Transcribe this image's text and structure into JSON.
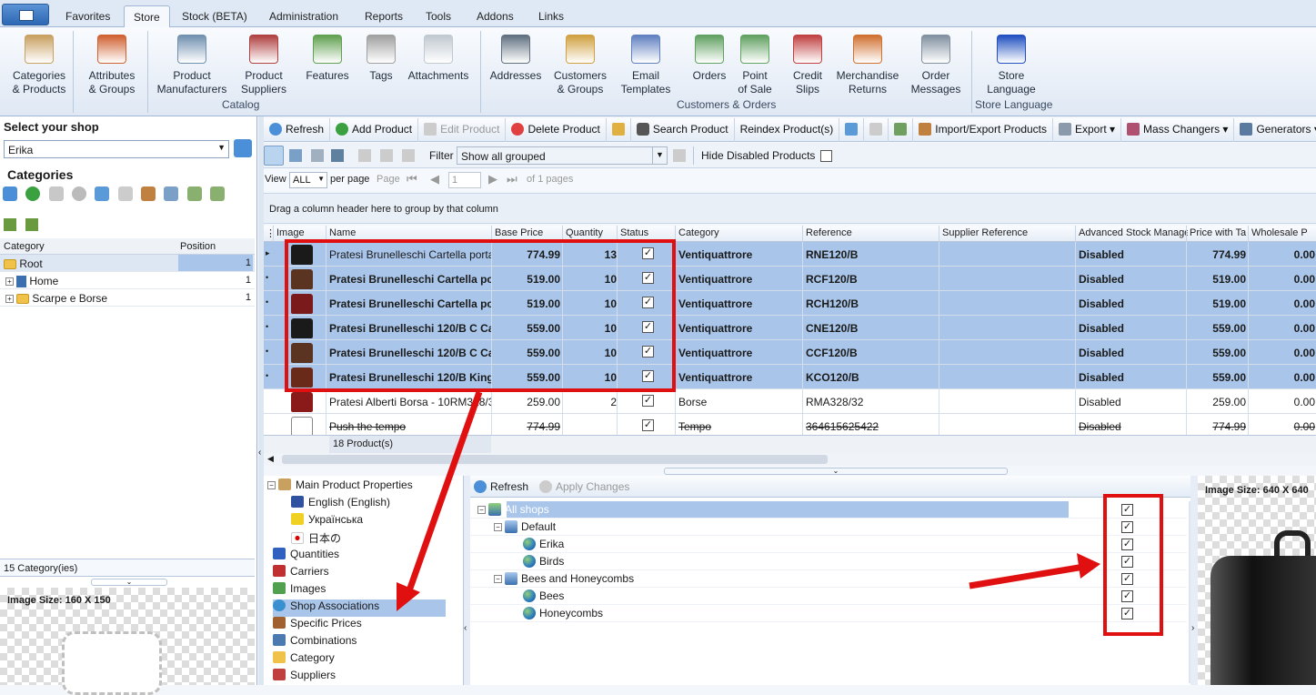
{
  "tabs": [
    "Favorites",
    "Store",
    "Stock (BETA)",
    "Administration",
    "Reports",
    "Tools",
    "Addons",
    "Links"
  ],
  "ribbon": {
    "buttons": [
      {
        "l1": "Categories",
        "l2": "& Products",
        "icon": "box-icon",
        "color": "#c8a060"
      },
      {
        "l1": "Attributes",
        "l2": "& Groups",
        "icon": "blocks-icon",
        "color": "#d06030"
      },
      {
        "l1": "Product",
        "l2": "Manufacturers",
        "icon": "factory-icon",
        "color": "#7090b0"
      },
      {
        "l1": "Product",
        "l2": "Suppliers",
        "icon": "shop-icon",
        "color": "#b04040"
      },
      {
        "l1": "Features",
        "l2": "",
        "icon": "cubes-icon",
        "color": "#60a050"
      },
      {
        "l1": "Tags",
        "l2": "",
        "icon": "tag-icon",
        "color": "#a0a0a0"
      },
      {
        "l1": "Attachments",
        "l2": "",
        "icon": "paperclip-icon",
        "color": "#c0c8d0"
      },
      {
        "l1": "Addresses",
        "l2": "",
        "icon": "address-book-icon",
        "color": "#607080"
      },
      {
        "l1": "Customers",
        "l2": "& Groups",
        "icon": "people-icon",
        "color": "#d0a040"
      },
      {
        "l1": "Email",
        "l2": "Templates",
        "icon": "email-icon",
        "color": "#6080c0"
      },
      {
        "l1": "Orders",
        "l2": "",
        "icon": "money-icon",
        "color": "#60a060"
      },
      {
        "l1": "Point",
        "l2": "of Sale",
        "icon": "money-pen-icon",
        "color": "#60a060"
      },
      {
        "l1": "Credit",
        "l2": "Slips",
        "icon": "credit-icon",
        "color": "#c04040"
      },
      {
        "l1": "Merchandise",
        "l2": "Returns",
        "icon": "returns-icon",
        "color": "#d07030"
      },
      {
        "l1": "Order",
        "l2": "Messages",
        "icon": "chat-icon",
        "color": "#8090a0"
      },
      {
        "l1": "Store",
        "l2": "Language",
        "icon": "language-icon",
        "color": "#2050c0"
      }
    ],
    "groups": [
      "Catalog",
      "Customers & Orders",
      "Store Language"
    ]
  },
  "left": {
    "select_title": "Select your shop",
    "shop_value": "Erika",
    "categories_title": "Categories",
    "col_category": "Category",
    "col_position": "Position",
    "rows": [
      {
        "name": "Root",
        "pos": "1"
      },
      {
        "name": "Home",
        "pos": "1"
      },
      {
        "name": "Scarpe e Borse",
        "pos": "1"
      }
    ],
    "footer": "15 Category(ies)",
    "image_size": "Image Size: 160 X 150"
  },
  "toolbar": {
    "refresh": "Refresh",
    "add": "Add Product",
    "edit": "Edit Product",
    "delete": "Delete Product",
    "search": "Search Product",
    "reindex": "Reindex Product(s)",
    "import": "Import/Export Products",
    "export": "Export",
    "mass": "Mass Changers",
    "gen": "Generators"
  },
  "filter": {
    "label": "Filter",
    "value": "Show all grouped",
    "hide_disabled": "Hide Disabled Products"
  },
  "pager": {
    "view": "View",
    "all": "ALL",
    "per_page": "per page",
    "page": "Page",
    "page_num": "1",
    "of": "of 1 pages"
  },
  "group_hint": "Drag a column header here to group by that column",
  "columns": [
    "Image",
    "Name",
    "Base Price",
    "Quantity",
    "Status",
    "Category",
    "Reference",
    "Supplier Reference",
    "Advanced Stock Manage",
    "Price with Ta",
    "Wholesale P"
  ],
  "products": [
    {
      "name": "Pratesi Brunelleschi Cartella porta PC",
      "price": "774.99",
      "qty": "13",
      "cat": "Ventiquattrore",
      "ref": "RNE120/B",
      "adv": "Disabled",
      "pwt": "774.99",
      "whole": "0.00",
      "sel": true,
      "bold": false,
      "color": "#1a1a1a"
    },
    {
      "name": "Pratesi Brunelleschi Cartella po",
      "price": "519.00",
      "qty": "10",
      "cat": "Ventiquattrore",
      "ref": "RCF120/B",
      "adv": "Disabled",
      "pwt": "519.00",
      "whole": "0.00",
      "sel": true,
      "bold": true,
      "color": "#5a3420"
    },
    {
      "name": "Pratesi Brunelleschi Cartella po",
      "price": "519.00",
      "qty": "10",
      "cat": "Ventiquattrore",
      "ref": "RCH120/B",
      "adv": "Disabled",
      "pwt": "519.00",
      "whole": "0.00",
      "sel": true,
      "bold": true,
      "color": "#7a1a1a"
    },
    {
      "name": "Pratesi Brunelleschi 120/B C Ca",
      "price": "559.00",
      "qty": "10",
      "cat": "Ventiquattrore",
      "ref": "CNE120/B",
      "adv": "Disabled",
      "pwt": "559.00",
      "whole": "0.00",
      "sel": true,
      "bold": true,
      "color": "#1a1a1a"
    },
    {
      "name": "Pratesi Brunelleschi 120/B C Ca",
      "price": "559.00",
      "qty": "10",
      "cat": "Ventiquattrore",
      "ref": "CCF120/B",
      "adv": "Disabled",
      "pwt": "559.00",
      "whole": "0.00",
      "sel": true,
      "bold": true,
      "color": "#5a3420"
    },
    {
      "name": "Pratesi Brunelleschi 120/B King",
      "price": "559.00",
      "qty": "10",
      "cat": "Ventiquattrore",
      "ref": "KCO120/B",
      "adv": "Disabled",
      "pwt": "559.00",
      "whole": "0.00",
      "sel": true,
      "bold": true,
      "color": "#6a2a1a"
    },
    {
      "name": "Pratesi Alberti Borsa - 10RM328/3",
      "price": "259.00",
      "qty": "2",
      "cat": "Borse",
      "ref": "RMA328/32",
      "adv": "Disabled",
      "pwt": "259.00",
      "whole": "0.00",
      "sel": false,
      "bold": false,
      "color": "#8a1a1a"
    },
    {
      "name": "Push the tempo",
      "price": "774.99",
      "qty": "",
      "cat": "Tempo",
      "ref": "364615625422",
      "adv": "Disabled",
      "pwt": "774.99",
      "whole": "0.00",
      "sel": false,
      "bold": false,
      "strike": true,
      "color": "#888"
    }
  ],
  "product_count": "18 Product(s)",
  "props": [
    "Main Product Properties",
    "English (English)",
    "Українська",
    "日本の",
    "Quantities",
    "Carriers",
    "Images",
    "Shop Associations",
    "Specific Prices",
    "Combinations",
    "Category",
    "Suppliers"
  ],
  "shop_tb": {
    "refresh": "Refresh",
    "apply": "Apply Changes"
  },
  "shops": [
    {
      "name": "All shops",
      "lvl": 0
    },
    {
      "name": "Default",
      "lvl": 1
    },
    {
      "name": "Erika",
      "lvl": 2
    },
    {
      "name": "Birds",
      "lvl": 2
    },
    {
      "name": "Bees and Honeycombs",
      "lvl": 1
    },
    {
      "name": "Bees",
      "lvl": 2
    },
    {
      "name": "Honeycombs",
      "lvl": 2
    }
  ],
  "right_image_size": "Image Size: 640 X 640"
}
